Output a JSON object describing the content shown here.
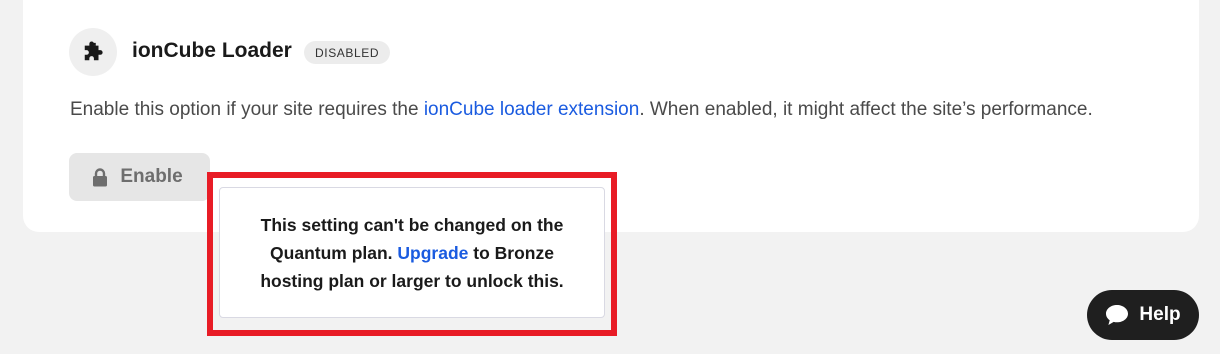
{
  "extension": {
    "icon": "puzzle-piece-icon",
    "title": "ionCube Loader",
    "status_badge": "DISABLED",
    "description_prefix": "Enable this option if your site requires the ",
    "description_link": "ionCube loader extension",
    "description_suffix": ". When enabled, it might affect the site’s performance.",
    "enable_button": {
      "icon": "lock-icon",
      "label": "Enable"
    }
  },
  "tooltip": {
    "text_before": "This setting can't be changed on the Quantum plan. ",
    "link": "Upgrade",
    "text_after": " to Bronze hosting plan or larger to unlock this."
  },
  "help_button": {
    "icon": "chat-bubble-icon",
    "label": "Help"
  },
  "colors": {
    "link": "#1a5be0",
    "highlight": "#e81c26",
    "help_bg": "#1f1f1f"
  }
}
